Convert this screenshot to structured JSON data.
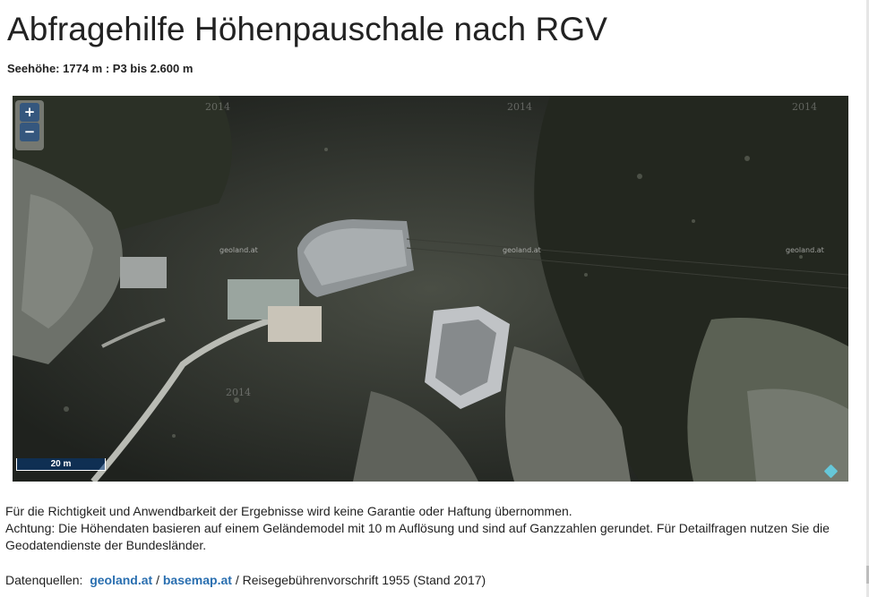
{
  "page": {
    "title": "Abfragehilfe Höhenpauschale nach RGV",
    "subtitle": "Seehöhe: 1774 m : P3 bis 2.600 m"
  },
  "map": {
    "zoom_in": "+",
    "zoom_out": "−",
    "scale_label": "20 m",
    "watermark_year": "2014",
    "watermark_brand": "geoland.at"
  },
  "notes": {
    "line1": "Für die Richtigkeit und Anwendbarkeit der Ergebnisse wird keine Garantie oder Haftung übernommen.",
    "line2": "Achtung: Die Höhendaten basieren auf einem Geländemodel mit 10 m Auflösung und sind auf Ganzzahlen gerundet. Für Detailfragen nutzen Sie die Geodatendienste der Bundesländer."
  },
  "sources": {
    "label": "Datenquellen:",
    "link1": "geoland.at",
    "sep": "/",
    "link2": "basemap.at",
    "suffix": "/ Reisegebührenvorschrift 1955 (Stand 2017)"
  },
  "colors": {
    "link": "#2a6fb0",
    "zoom_button": "#003c88",
    "attribution": "#66c7d9"
  }
}
